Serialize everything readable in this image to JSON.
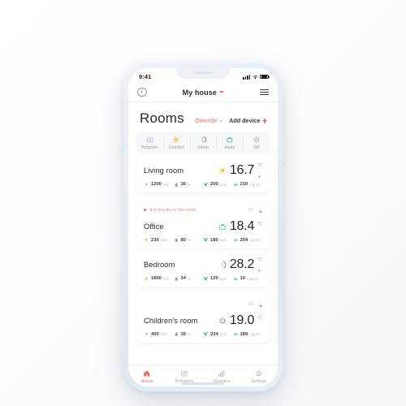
{
  "status_bar": {
    "time": "9:41",
    "signal_icon": "signal-bars-icon",
    "wifi_icon": "wifi-icon",
    "battery_icon": "battery-icon"
  },
  "app_bar": {
    "info_icon": "info-icon",
    "info_glyph": "i",
    "title": "My house",
    "chevron_icon": "chevron-down-icon",
    "menu_icon": "hamburger-menu-icon"
  },
  "page": {
    "title": "Rooms",
    "override_label": "Override",
    "override_chevron": "chevron-up-icon",
    "add_device_label": "Add device",
    "add_device_icon": "plus-icon"
  },
  "modes": [
    {
      "label": "Program",
      "icon": "calendar-icon",
      "color": "#b9bcc6",
      "active": false
    },
    {
      "label": "Comfort",
      "icon": "sun-icon",
      "color": "#f9b233",
      "active": false
    },
    {
      "label": "Sleep",
      "icon": "moon-icon",
      "color": "#8e3a63",
      "active": false
    },
    {
      "label": "Away",
      "icon": "briefcase-icon",
      "color": "#35c194",
      "active": false
    },
    {
      "label": "Off",
      "icon": "power-icon",
      "color": "#9a9aa3",
      "active": false
    }
  ],
  "rooms": [
    {
      "name": "Living room",
      "mode_icon": "sun-icon",
      "mode_color": "#f9b233",
      "temperature": "16.7",
      "unit": "°C",
      "heating": true,
      "alert": null,
      "alert_count": null,
      "metrics": [
        {
          "icon": "energy-bolt-icon",
          "value": "1200",
          "unit": "kwh",
          "color": "#f7a72a"
        },
        {
          "icon": "humidity-drop-icon",
          "value": "36",
          "unit": "%",
          "color": "#9aa3ae"
        },
        {
          "icon": "co2-icon",
          "value": "200",
          "unit": "ppm",
          "color": "#2bbd7e"
        },
        {
          "icon": "dust-cloud-icon",
          "value": "210",
          "unit": "mg/m3",
          "color": "#8ed2ea"
        }
      ]
    },
    {
      "name": "Office",
      "mode_icon": "briefcase-icon",
      "mode_color": "#35c194",
      "temperature": "18.4",
      "unit": "°C",
      "heating": false,
      "alert": "It is too dry in the room.",
      "alert_count": "1/2",
      "alert_icon": "dry-air-icon",
      "metrics": [
        {
          "icon": "energy-bolt-icon",
          "value": "230",
          "unit": "kwh",
          "color": "#f7a72a"
        },
        {
          "icon": "humidity-drop-icon",
          "value": "80",
          "unit": "%",
          "color": "#9aa3ae"
        },
        {
          "icon": "co2-icon",
          "value": "180",
          "unit": "ppm",
          "color": "#2bbd7e"
        },
        {
          "icon": "dust-cloud-icon",
          "value": "204",
          "unit": "mg/m3",
          "color": "#8ed2ea"
        }
      ]
    },
    {
      "name": "Bedroom",
      "mode_icon": "moon-icon",
      "mode_color": "#8e3a63",
      "temperature": "28.2",
      "unit": "°C",
      "heating": true,
      "alert": null,
      "alert_count": null,
      "metrics": [
        {
          "icon": "energy-bolt-icon",
          "value": "1800",
          "unit": "kwh",
          "color": "#f7a72a"
        },
        {
          "icon": "humidity-drop-icon",
          "value": "34",
          "unit": "%",
          "color": "#9aa3ae"
        },
        {
          "icon": "co2-icon",
          "value": "120",
          "unit": "ppm",
          "color": "#2bbd7e"
        },
        {
          "icon": "dust-cloud-icon",
          "value": "10",
          "unit": "mg/m3",
          "color": "#8ed2ea"
        }
      ]
    },
    {
      "name": "Children's room",
      "mode_icon": "power-icon",
      "mode_color": "#6f6f78",
      "temperature": "19.0",
      "unit": "°C",
      "heating": false,
      "alert": "",
      "alert_count": "1/2",
      "alert_icon": "dry-air-icon",
      "metrics": [
        {
          "icon": "energy-bolt-icon",
          "value": "400",
          "unit": "kwh",
          "color": "#f7a72a"
        },
        {
          "icon": "humidity-drop-icon",
          "value": "35",
          "unit": "%",
          "color": "#9aa3ae"
        },
        {
          "icon": "co2-icon",
          "value": "234",
          "unit": "ppm",
          "color": "#2bbd7e"
        },
        {
          "icon": "dust-cloud-icon",
          "value": "189",
          "unit": "mg/m3",
          "color": "#8ed2ea"
        }
      ]
    }
  ],
  "tabs": [
    {
      "label": "House",
      "icon": "home-icon",
      "active": true
    },
    {
      "label": "Programs",
      "icon": "calendar-icon",
      "active": false
    },
    {
      "label": "Statistics",
      "icon": "bar-chart-icon",
      "active": false
    },
    {
      "label": "Settings",
      "icon": "gear-icon",
      "active": false
    }
  ],
  "colors": {
    "accent": "#f4685c",
    "warm": "#f9b233",
    "green": "#35c194",
    "muted": "#a8a8b0"
  }
}
